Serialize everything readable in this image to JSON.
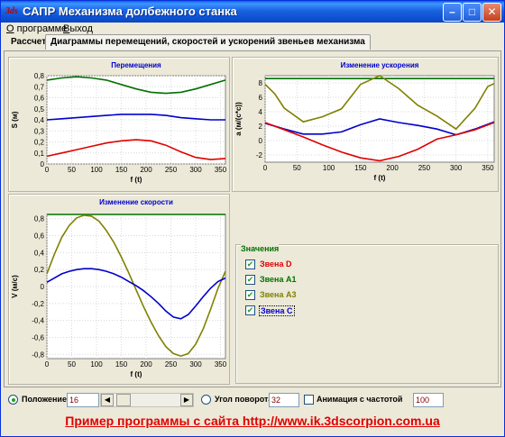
{
  "window": {
    "title": "САПР Механизма долбежного станка",
    "icon": "3ds-logo-icon"
  },
  "menu": [
    {
      "label": "О программе",
      "accel": "О",
      "rest": " программе"
    },
    {
      "label": "Выход",
      "accel": "В",
      "rest": "ыход"
    }
  ],
  "tabs": [
    {
      "label": "Рассчет"
    },
    {
      "label": "Диаграммы перемещений, скоростей и ускорений звеньев механизма",
      "active": true
    }
  ],
  "values_group": {
    "title": "Значения",
    "items": [
      {
        "label": "Звена D",
        "checked": true,
        "color": "#E00000"
      },
      {
        "label": "Звена A1",
        "checked": true,
        "color": "#007000"
      },
      {
        "label": "Звена A3",
        "checked": true,
        "color": "#808000"
      },
      {
        "label": "Звена C",
        "checked": true,
        "color": "#0000CC"
      }
    ]
  },
  "controls": {
    "position_label": "Положение",
    "position_value": "16",
    "angle_label": "Угол поворота",
    "angle_value": "32",
    "animation_label": "Анимация с частотой",
    "animation_value": "100",
    "position_selected": true,
    "animation_checked": false
  },
  "footer": "Пример программы с сайта http://www.ik.3dscorpion.com.ua",
  "chart_data": [
    {
      "type": "line",
      "title": "Перемещения",
      "xlabel": "f (t)",
      "ylabel": "S (м)",
      "xlim": [
        0,
        360
      ],
      "ylim": [
        0,
        0.8
      ],
      "xticks": [
        "0",
        "50",
        "100",
        "150",
        "200",
        "250",
        "300",
        "350"
      ],
      "yticks": [
        "0",
        "0,1",
        "0,2",
        "0,3",
        "0,4",
        "0,5",
        "0,6",
        "0,7",
        "0,8"
      ],
      "grid": true,
      "series": [
        {
          "color": "#007000",
          "x": [
            0,
            30,
            60,
            90,
            120,
            150,
            180,
            210,
            240,
            270,
            300,
            330,
            360
          ],
          "y": [
            0.76,
            0.78,
            0.79,
            0.78,
            0.76,
            0.72,
            0.68,
            0.65,
            0.64,
            0.65,
            0.68,
            0.72,
            0.76
          ]
        },
        {
          "color": "#0000CC",
          "x": [
            0,
            30,
            60,
            90,
            120,
            150,
            180,
            210,
            240,
            270,
            300,
            330,
            360
          ],
          "y": [
            0.4,
            0.41,
            0.42,
            0.43,
            0.44,
            0.45,
            0.45,
            0.45,
            0.44,
            0.42,
            0.41,
            0.4,
            0.4
          ]
        },
        {
          "color": "#E00000",
          "x": [
            0,
            30,
            60,
            90,
            120,
            150,
            180,
            210,
            240,
            270,
            300,
            330,
            360
          ],
          "y": [
            0.07,
            0.1,
            0.13,
            0.16,
            0.19,
            0.21,
            0.22,
            0.21,
            0.17,
            0.11,
            0.06,
            0.04,
            0.05
          ]
        }
      ]
    },
    {
      "type": "line",
      "title": "Изменение ускорения",
      "xlabel": "f (t)",
      "ylabel": "a (м/(с*с))",
      "xlim": [
        0,
        360
      ],
      "ylim": [
        -3,
        9
      ],
      "xticks": [
        "0",
        "50",
        "100",
        "150",
        "200",
        "250",
        "300",
        "350"
      ],
      "yticks": [
        "-2",
        "0",
        "2",
        "4",
        "6",
        "8"
      ],
      "grid": true,
      "series": [
        {
          "color": "#007000",
          "x": [
            0,
            360
          ],
          "y": [
            8.6,
            8.6
          ]
        },
        {
          "color": "#808000",
          "x": [
            0,
            15,
            30,
            60,
            90,
            120,
            150,
            180,
            210,
            240,
            270,
            300,
            330,
            350,
            360
          ],
          "y": [
            7.8,
            6.5,
            4.5,
            2.6,
            3.3,
            4.4,
            7.8,
            9.0,
            7.2,
            4.9,
            3.4,
            1.6,
            4.5,
            7.5,
            7.9
          ]
        },
        {
          "color": "#0000CC",
          "x": [
            0,
            30,
            60,
            90,
            120,
            150,
            180,
            210,
            240,
            270,
            300,
            330,
            360
          ],
          "y": [
            2.4,
            1.6,
            0.9,
            0.9,
            1.2,
            2.2,
            3.0,
            2.5,
            2.1,
            1.6,
            0.8,
            1.6,
            2.6
          ]
        },
        {
          "color": "#E00000",
          "x": [
            0,
            30,
            60,
            90,
            120,
            150,
            180,
            210,
            240,
            270,
            300,
            330,
            360
          ],
          "y": [
            2.5,
            1.5,
            0.5,
            -0.6,
            -1.6,
            -2.4,
            -2.8,
            -2.2,
            -1.2,
            0.2,
            0.8,
            1.5,
            2.5
          ]
        }
      ]
    },
    {
      "type": "line",
      "title": "Изменение скорости",
      "xlabel": "f (t)",
      "ylabel": "V (м/с)",
      "xlim": [
        0,
        360
      ],
      "ylim": [
        -0.85,
        0.85
      ],
      "xticks": [
        "0",
        "50",
        "100",
        "150",
        "200",
        "250",
        "300",
        "350"
      ],
      "yticks": [
        "-0,8",
        "-0,6",
        "-0,4",
        "-0,2",
        "0",
        "0,2",
        "0,4",
        "0,6",
        "0,8"
      ],
      "grid": true,
      "series": [
        {
          "color": "#007000",
          "x": [
            0,
            360
          ],
          "y": [
            0.85,
            0.85
          ]
        },
        {
          "color": "#808000",
          "x": [
            0,
            15,
            30,
            45,
            60,
            75,
            90,
            105,
            120,
            135,
            150,
            165,
            180,
            195,
            210,
            225,
            240,
            255,
            270,
            285,
            300,
            315,
            330,
            345,
            360
          ],
          "y": [
            0.15,
            0.38,
            0.58,
            0.72,
            0.81,
            0.84,
            0.83,
            0.77,
            0.66,
            0.52,
            0.35,
            0.16,
            -0.04,
            -0.24,
            -0.42,
            -0.58,
            -0.71,
            -0.79,
            -0.82,
            -0.79,
            -0.68,
            -0.5,
            -0.27,
            -0.02,
            0.18
          ]
        },
        {
          "color": "#0000CC",
          "x": [
            0,
            15,
            30,
            45,
            60,
            75,
            90,
            105,
            120,
            135,
            150,
            165,
            180,
            195,
            210,
            225,
            240,
            255,
            270,
            285,
            300,
            315,
            330,
            345,
            360
          ],
          "y": [
            0.05,
            0.1,
            0.15,
            0.18,
            0.2,
            0.21,
            0.21,
            0.2,
            0.18,
            0.15,
            0.11,
            0.06,
            0.01,
            -0.05,
            -0.12,
            -0.2,
            -0.29,
            -0.36,
            -0.38,
            -0.33,
            -0.23,
            -0.12,
            -0.02,
            0.06,
            0.1
          ]
        }
      ]
    }
  ]
}
